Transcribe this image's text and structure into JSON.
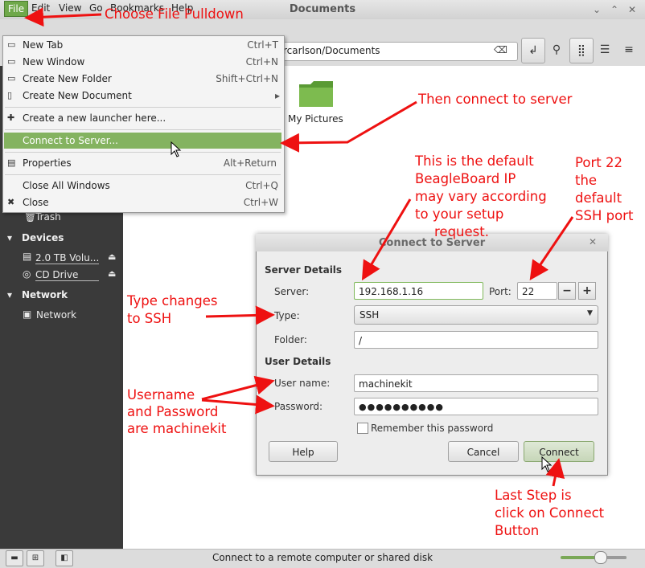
{
  "window": {
    "title": "Documents",
    "minimize": "⌄",
    "maximize": "⌃",
    "close": "✕"
  },
  "menubar": {
    "file": "File",
    "edit": "Edit",
    "view": "View",
    "go": "Go",
    "bookmarks": "Bookmarks",
    "help": "Help"
  },
  "location": {
    "path": "rcarlson/Documents"
  },
  "file_menu": {
    "items": [
      {
        "label": "New Tab",
        "shortcut": "Ctrl+T"
      },
      {
        "label": "New Window",
        "shortcut": "Ctrl+N"
      },
      {
        "label": "Create New Folder",
        "shortcut": "Shift+Ctrl+N"
      },
      {
        "label": "Create New Document",
        "shortcut": "▸"
      },
      {
        "label": "Create a new launcher here...",
        "shortcut": ""
      },
      {
        "label": "Connect to Server...",
        "shortcut": ""
      },
      {
        "label": "Properties",
        "shortcut": "Alt+Return"
      },
      {
        "label": "Close All Windows",
        "shortcut": "Ctrl+Q"
      },
      {
        "label": "Close",
        "shortcut": "Ctrl+W"
      }
    ]
  },
  "sidebar": {
    "trash": "Trash",
    "devices_header": "Devices",
    "device_volume": "2.0 TB Volu...",
    "device_cd": "CD Drive",
    "network_header": "Network",
    "network_item": "Network"
  },
  "content": {
    "folder_label": "My Pictures"
  },
  "statusbar": {
    "text": "Connect to a remote computer or shared disk",
    "zoom_fraction": 0.5
  },
  "dialog": {
    "title": "Connect to Server",
    "server_details": "Server Details",
    "server_label": "Server:",
    "server_value": "192.168.1.16",
    "port_label": "Port:",
    "port_value": "22",
    "minus": "−",
    "plus": "+",
    "type_label": "Type:",
    "type_value": "SSH",
    "folder_label": "Folder:",
    "folder_value": "/",
    "user_details": "User Details",
    "username_label": "User name:",
    "username_value": "machinekit",
    "password_label": "Password:",
    "password_value": "●●●●●●●●●●",
    "remember_label": "Remember this password",
    "help_button": "Help",
    "cancel_button": "Cancel",
    "connect_button": "Connect"
  },
  "annotations": {
    "choose_file": "Choose File Pulldown",
    "connect_server": "Then connect to server",
    "ip_note": [
      "This is the default",
      "BeagleBoard IP",
      "may vary according",
      "to your setup",
      "request."
    ],
    "port_note": [
      "Port 22",
      "the",
      "default",
      "SSH port"
    ],
    "type_note": [
      "Type changes",
      "to SSH"
    ],
    "creds_note": [
      "Username",
      "and Password",
      "are machinekit"
    ],
    "last_step": [
      "Last Step is",
      "click on Connect",
      "Button"
    ]
  },
  "colors": {
    "annotation": "#ee1111",
    "highlight": "#84b360",
    "sidebar": "#3a3a3a"
  }
}
